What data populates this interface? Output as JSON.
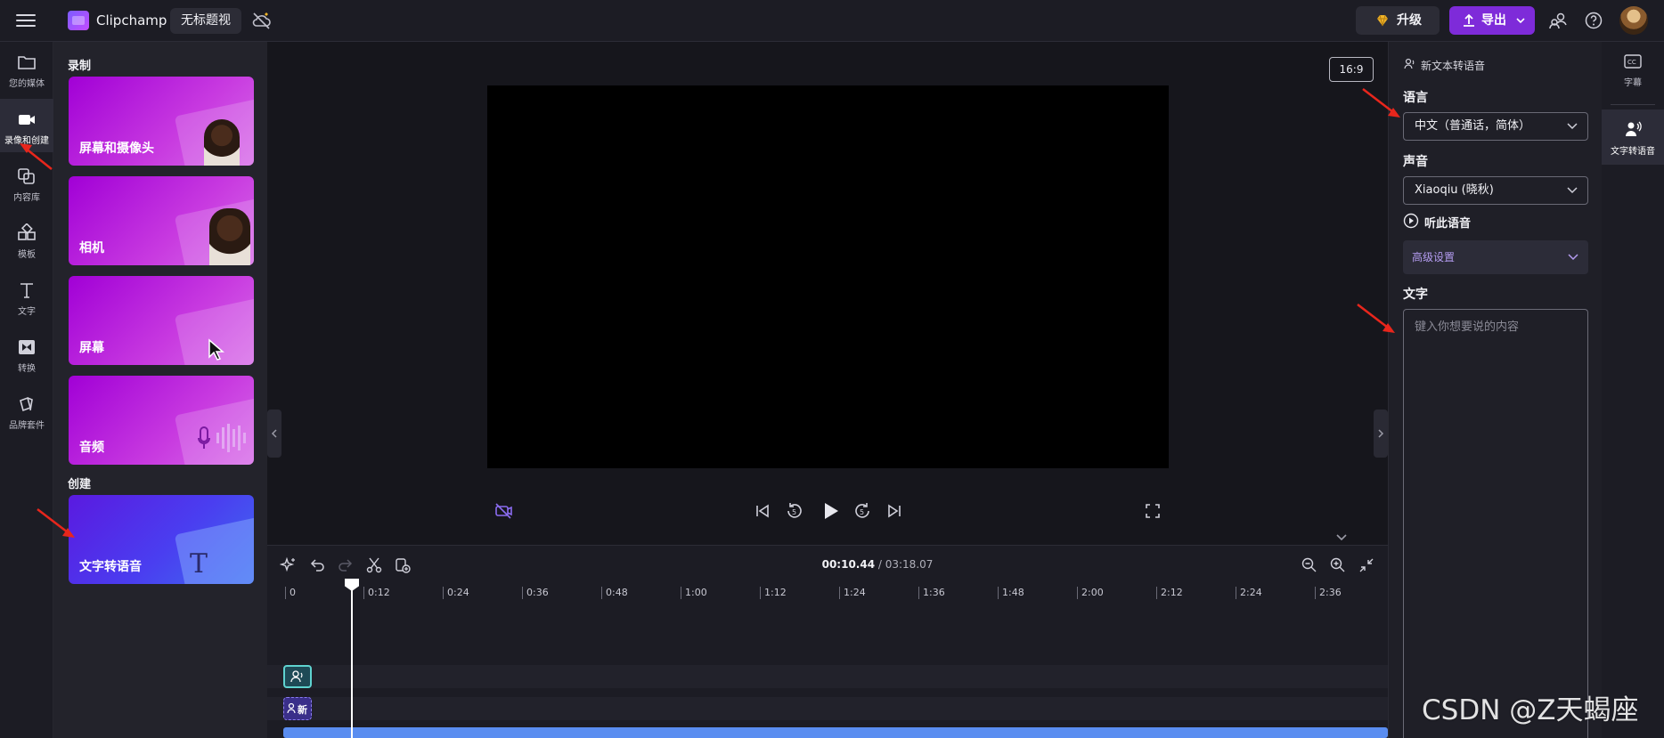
{
  "header": {
    "app_name": "Clipchamp",
    "project_title": "无标题视",
    "upgrade_label": "升级",
    "export_label": "导出"
  },
  "left_rail": {
    "items": [
      {
        "label": "您的媒体",
        "icon": "folder-icon"
      },
      {
        "label": "录像和创建",
        "icon": "video-camera-icon",
        "active": true
      },
      {
        "label": "内容库",
        "icon": "library-icon"
      },
      {
        "label": "模板",
        "icon": "templates-icon"
      },
      {
        "label": "文字",
        "icon": "text-icon"
      },
      {
        "label": "转换",
        "icon": "transitions-icon"
      },
      {
        "label": "品牌套件",
        "icon": "brand-kit-icon"
      }
    ]
  },
  "media_panel": {
    "record_title": "录制",
    "record_cards": [
      {
        "label": "屏幕和摄像头"
      },
      {
        "label": "相机"
      },
      {
        "label": "屏幕"
      },
      {
        "label": "音频"
      }
    ],
    "create_title": "创建",
    "create_cards": [
      {
        "label": "文字转语音"
      }
    ]
  },
  "preview": {
    "aspect_ratio": "16:9"
  },
  "timeline": {
    "current_time": "00:10.44",
    "separator": " / ",
    "total_time": "03:18.07",
    "ruler_ticks": [
      "0",
      "0:12",
      "0:24",
      "0:36",
      "0:48",
      "1:00",
      "1:12",
      "1:24",
      "1:36",
      "1:48",
      "2:00",
      "2:12",
      "2:24",
      "2:36"
    ],
    "tts_track_label": "新"
  },
  "tts_panel": {
    "header": "新文本转语音",
    "language_label": "语言",
    "language_value": "中文（普通话，简体）",
    "voice_label": "声音",
    "voice_value": "Xiaoqiu (晓秋)",
    "preview_voice": "听此语音",
    "advanced_settings": "高级设置",
    "text_label": "文字",
    "text_placeholder": "键入你想要说的内容"
  },
  "right_rail": {
    "items": [
      {
        "label": "字幕",
        "icon": "captions-icon"
      },
      {
        "label": "文字转语音",
        "icon": "text-to-speech-icon",
        "active": true
      }
    ]
  },
  "watermark": "CSDN @Z天蝎座",
  "colors": {
    "accent_purple": "#7e2bd9",
    "card_magenta": "#b51ad9",
    "tts_card_blue": "#4a3ef0",
    "annotation_red": "#e8261c"
  }
}
